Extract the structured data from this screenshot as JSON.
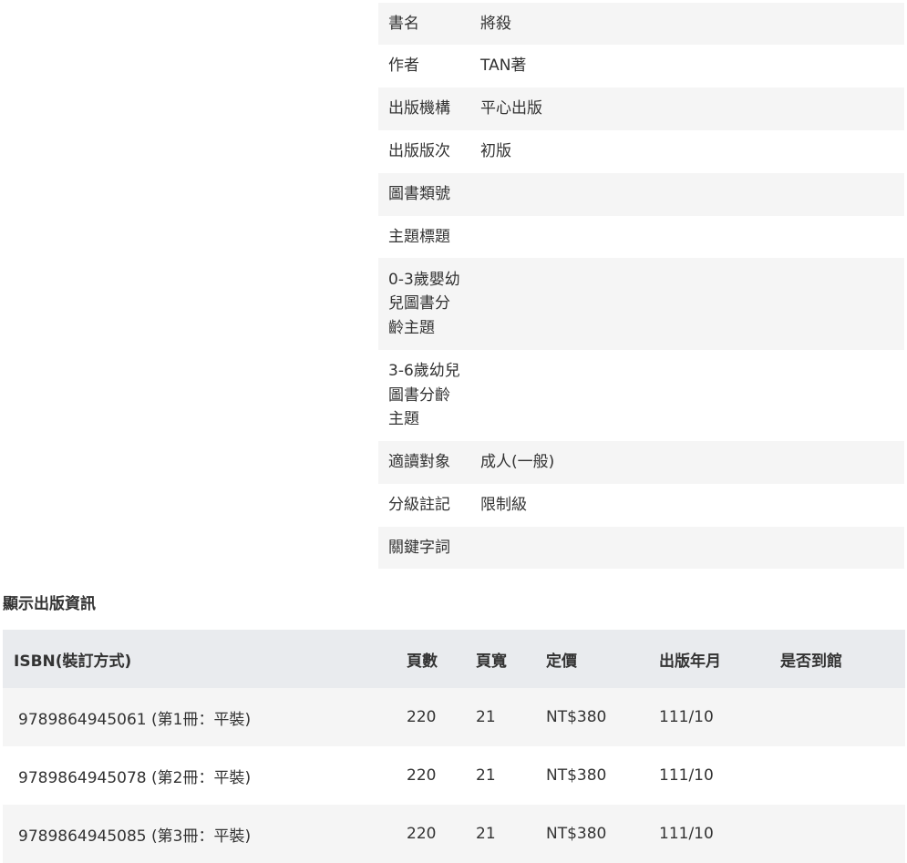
{
  "book_info": {
    "rows": [
      {
        "label": "書名",
        "value": "將殺"
      },
      {
        "label": "作者",
        "value": "TAN著"
      },
      {
        "label": "出版機構",
        "value": "平心出版"
      },
      {
        "label": "出版版次",
        "value": "初版"
      },
      {
        "label": "圖書類號",
        "value": ""
      },
      {
        "label": "主題標題",
        "value": ""
      },
      {
        "label_lines": [
          "0-3歲嬰幼",
          "兒圖書分",
          "齡主題"
        ],
        "value": ""
      },
      {
        "label_lines": [
          "3-6歲幼兒",
          "圖書分齡",
          "主題"
        ],
        "value": ""
      },
      {
        "label": "適讀對象",
        "value": "成人(一般)"
      },
      {
        "label": "分級註記",
        "value": "限制級"
      },
      {
        "label": "關鍵字詞",
        "value": ""
      }
    ]
  },
  "publication": {
    "section_title": "顯示出版資訊",
    "headers": {
      "isbn": "ISBN(裝訂方式)",
      "pages": "頁數",
      "width": "頁寬",
      "price": "定價",
      "date": "出版年月",
      "arrived": "是否到館"
    },
    "rows": [
      {
        "isbn": "9789864945061 (第1冊：平裝)",
        "pages": "220",
        "width": "21",
        "price": "NT$380",
        "date": "111/10",
        "arrived": ""
      },
      {
        "isbn": "9789864945078 (第2冊：平裝)",
        "pages": "220",
        "width": "21",
        "price": "NT$380",
        "date": "111/10",
        "arrived": ""
      },
      {
        "isbn": "9789864945085 (第3冊：平裝)",
        "pages": "220",
        "width": "21",
        "price": "NT$380",
        "date": "111/10",
        "arrived": ""
      }
    ]
  }
}
